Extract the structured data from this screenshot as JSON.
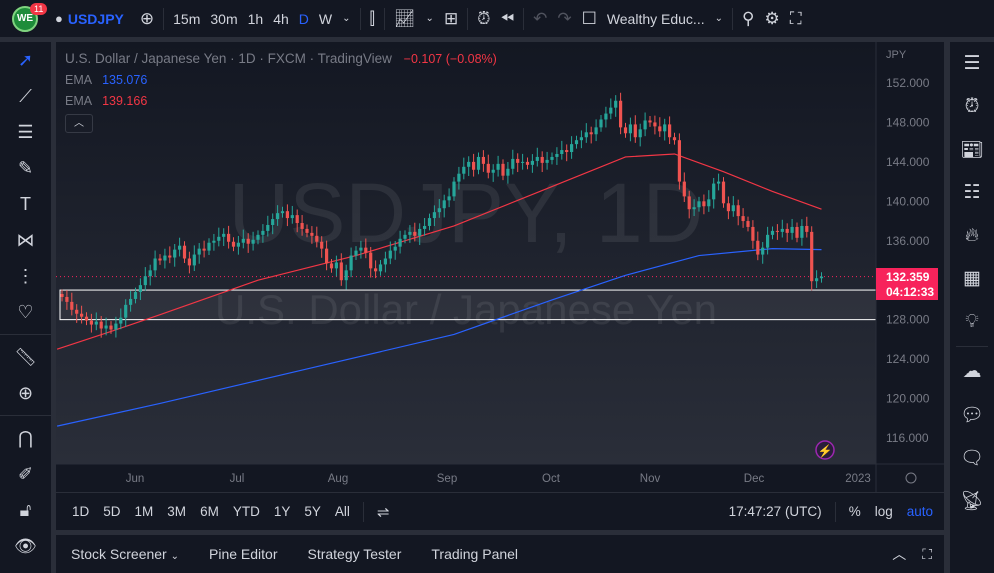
{
  "topbar": {
    "badge": "11",
    "symbol": "USDJPY",
    "intervals": [
      "15m",
      "30m",
      "1h",
      "4h",
      "D",
      "W"
    ],
    "active_interval": "D",
    "layout_name": "Wealthy Educ..."
  },
  "legend": {
    "title": "U.S. Dollar / Japanese Yen · 1D · FXCM · TradingView",
    "change": "−0.107 (−0.08%)",
    "ema1_label": "EMA",
    "ema1_value": "135.076",
    "ema2_label": "EMA",
    "ema2_value": "139.166"
  },
  "watermark": {
    "symbol": "USDJPY, 1D",
    "name": "U.S. Dollar / Japanese Yen"
  },
  "price_axis": {
    "currency": "JPY",
    "ticks": [
      "152.000",
      "148.000",
      "144.000",
      "140.000",
      "136.000",
      "128.000",
      "124.000",
      "120.000",
      "116.000"
    ],
    "last_price": "132.359",
    "countdown": "04:12:33"
  },
  "time_axis": {
    "ticks": [
      "Jun",
      "Jul",
      "Aug",
      "Sep",
      "Oct",
      "Nov",
      "Dec",
      "2023"
    ]
  },
  "range_bar": {
    "ranges": [
      "1D",
      "5D",
      "1M",
      "3M",
      "6M",
      "YTD",
      "1Y",
      "5Y",
      "All"
    ],
    "clock": "17:47:27 (UTC)",
    "percent": "%",
    "log": "log",
    "auto": "auto"
  },
  "bottom_tabs": [
    "Stock Screener",
    "Pine Editor",
    "Strategy Tester",
    "Trading Panel"
  ],
  "colors": {
    "up": "#26a69a",
    "down": "#ef5350",
    "ema_blue": "#2962ff",
    "ema_red": "#f23645",
    "accent": "#2962ff",
    "price_tag": "#f7235b"
  },
  "chart_data": {
    "type": "candlestick",
    "symbol": "USDJPY",
    "ylim": [
      114,
      154
    ],
    "last": 132.359,
    "rectangle": [
      128.0,
      131.0
    ],
    "closes": [
      130.3,
      129.8,
      129.0,
      128.6,
      128.3,
      127.9,
      127.5,
      127.8,
      127.1,
      127.4,
      127.0,
      127.6,
      128.2,
      129.5,
      130.1,
      130.8,
      131.5,
      132.4,
      133.0,
      134.2,
      134.0,
      134.5,
      134.3,
      135.1,
      135.5,
      134.2,
      133.5,
      134.6,
      135.2,
      135.0,
      135.8,
      136.0,
      136.4,
      136.7,
      135.9,
      135.4,
      135.8,
      136.2,
      135.7,
      136.1,
      136.6,
      137.0,
      137.6,
      138.2,
      138.8,
      139.0,
      138.3,
      138.6,
      137.8,
      137.2,
      136.8,
      136.5,
      135.9,
      135.2,
      133.7,
      133.2,
      133.8,
      132.0,
      133.0,
      134.5,
      135.0,
      135.3,
      134.8,
      133.2,
      132.9,
      133.6,
      134.2,
      135.0,
      135.4,
      136.2,
      136.6,
      136.9,
      136.5,
      137.2,
      137.5,
      138.3,
      138.9,
      139.3,
      140.1,
      140.5,
      142.0,
      142.8,
      143.5,
      144.0,
      143.2,
      144.5,
      143.8,
      142.9,
      143.2,
      143.8,
      142.6,
      143.3,
      144.3,
      143.9,
      144.0,
      143.7,
      144.1,
      144.5,
      143.9,
      144.2,
      144.5,
      144.8,
      145.2,
      145.0,
      145.8,
      146.2,
      146.5,
      147.0,
      146.8,
      147.5,
      148.3,
      148.9,
      149.5,
      150.2,
      147.5,
      146.9,
      147.8,
      146.5,
      147.3,
      148.2,
      148.0,
      147.6,
      147.1,
      147.8,
      146.5,
      146.2,
      142.0,
      140.5,
      139.2,
      139.4,
      140.0,
      139.5,
      140.2,
      141.8,
      142.0,
      139.8,
      139.0,
      139.6,
      138.5,
      138.0,
      137.4,
      136.0,
      134.6,
      135.3,
      136.6,
      137.0,
      136.9,
      137.2,
      136.8,
      137.4,
      136.3,
      137.5,
      136.9,
      131.9,
      132.2,
      132.36
    ],
    "ema_red": [
      [
        -1,
        125
      ],
      [
        10,
        126.8
      ],
      [
        20,
        128.5
      ],
      [
        40,
        132
      ],
      [
        60,
        134.5
      ],
      [
        80,
        137.5
      ],
      [
        100,
        141.5
      ],
      [
        115,
        144.5
      ],
      [
        125,
        144.8
      ],
      [
        135,
        143
      ],
      [
        145,
        141
      ],
      [
        155,
        139.2
      ]
    ],
    "ema_blue": [
      [
        -1,
        117.2
      ],
      [
        20,
        119.5
      ],
      [
        50,
        123
      ],
      [
        80,
        126.5
      ],
      [
        100,
        130
      ],
      [
        115,
        132.5
      ],
      [
        130,
        134.5
      ],
      [
        145,
        135.2
      ],
      [
        155,
        135.1
      ]
    ]
  }
}
